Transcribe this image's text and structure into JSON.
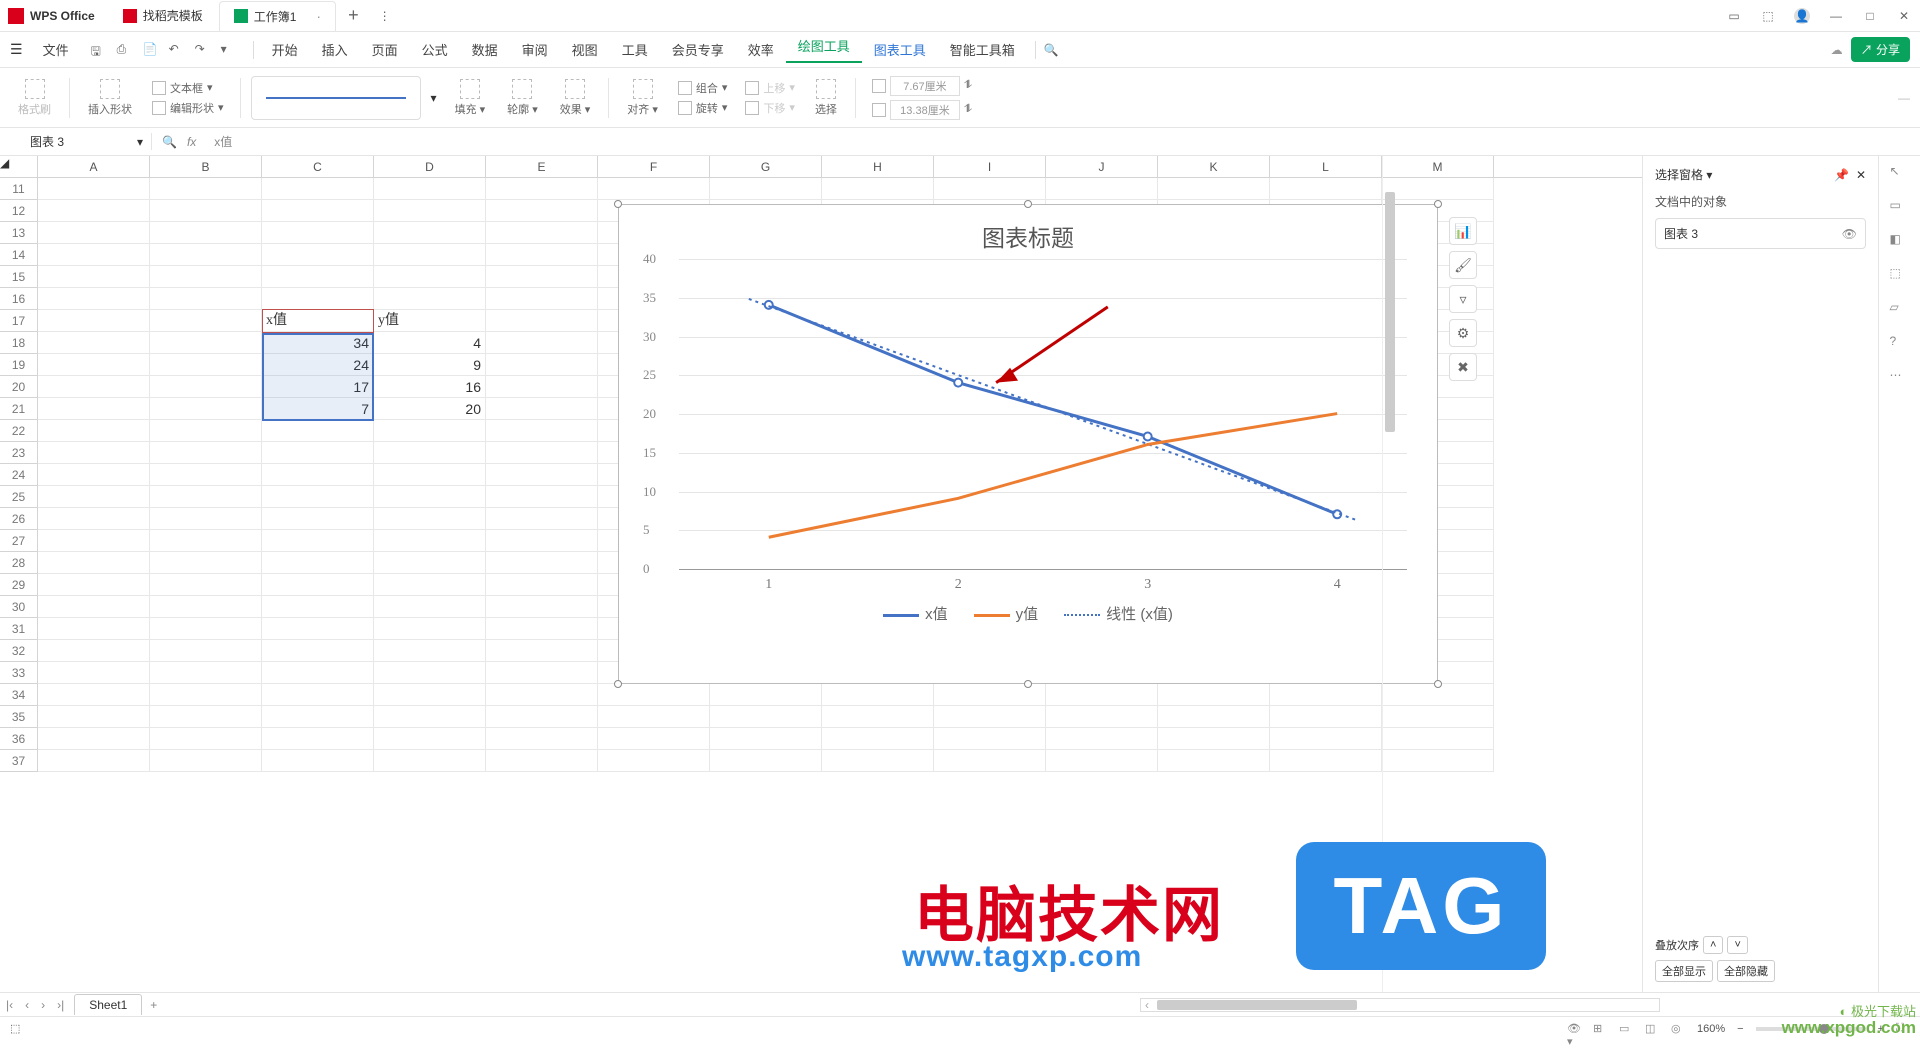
{
  "app": {
    "name": "WPS Office"
  },
  "tabs": [
    {
      "label": "找稻壳模板",
      "icon": "red"
    },
    {
      "label": "工作簿1",
      "icon": "green",
      "active": true
    }
  ],
  "menu": {
    "file": "文件",
    "items": [
      "开始",
      "插入",
      "页面",
      "公式",
      "数据",
      "审阅",
      "视图",
      "工具",
      "会员专享",
      "效率",
      "绘图工具",
      "图表工具",
      "智能工具箱"
    ]
  },
  "ribbon": {
    "format_painter": "格式刷",
    "insert_shape": "插入形状",
    "text_box": "文本框",
    "edit_shape": "编辑形状",
    "fill": "填充",
    "outline": "轮廓",
    "effect": "效果",
    "align": "对齐",
    "group": "组合",
    "rotate": "旋转",
    "move_up": "上移",
    "move_down": "下移",
    "select": "选择",
    "width": "7.67厘米",
    "height": "13.38厘米"
  },
  "namebox": "图表 3",
  "formula_text": "x值",
  "columns": [
    "A",
    "B",
    "C",
    "D",
    "E",
    "F",
    "G",
    "H",
    "I",
    "J",
    "K",
    "L",
    "M"
  ],
  "first_row": 11,
  "last_row": 37,
  "table": {
    "header": {
      "c": "x值",
      "d": "y值",
      "row": 17
    },
    "rows": [
      {
        "r": 18,
        "c": 34,
        "d": 4
      },
      {
        "r": 19,
        "c": 24,
        "d": 9
      },
      {
        "r": 20,
        "c": 17,
        "d": 16
      },
      {
        "r": 21,
        "c": 7,
        "d": 20
      }
    ]
  },
  "chart_data": {
    "type": "line",
    "title": "图表标题",
    "x": [
      1,
      2,
      3,
      4
    ],
    "ylim": [
      0,
      40
    ],
    "yticks": [
      0,
      5,
      10,
      15,
      20,
      25,
      30,
      35,
      40
    ],
    "series": [
      {
        "name": "x值",
        "values": [
          34,
          24,
          17,
          7
        ],
        "color": "#4472c4"
      },
      {
        "name": "y值",
        "values": [
          4,
          9,
          16,
          20
        ],
        "color": "#ed7d31"
      }
    ],
    "trendline": {
      "name": "线性 (x值)",
      "style": "dotted",
      "color": "#4472c4"
    },
    "legend": [
      "x值",
      "y值",
      "线性 (x值)"
    ]
  },
  "sidepane": {
    "title": "选择窗格",
    "subtitle": "文档中的对象",
    "object": "图表 3",
    "stack": "叠放次序",
    "show_all": "全部显示",
    "hide_all": "全部隐藏"
  },
  "sheet": {
    "name": "Sheet1"
  },
  "status": {
    "zoom": "160%"
  },
  "share": "分享",
  "watermark": {
    "text": "电脑技术网",
    "url": "www.tagxp.com",
    "tag": "TAG",
    "corner1": "极光下载站",
    "corner2": "www.xpgod.com"
  }
}
